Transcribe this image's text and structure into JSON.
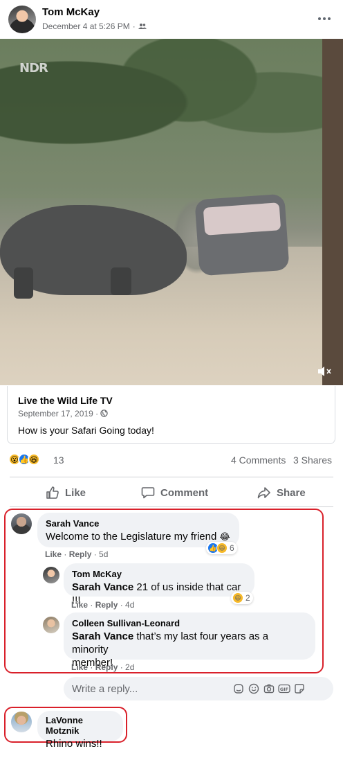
{
  "post": {
    "author": "Tom McKay",
    "time": "December 4 at 5:26 PM",
    "audience_icon": "friends-icon",
    "more_icon": "more-icon"
  },
  "video": {
    "watermark": "NDR",
    "mute_icon": "speaker-muted-icon"
  },
  "link_card": {
    "title": "Live the Wild Life TV",
    "date": "September 17, 2019 ·",
    "globe_icon": "globe-icon",
    "text": "How is your Safari Going today!"
  },
  "summary": {
    "reaction_icons": [
      "wow-icon",
      "like-icon",
      "haha-icon"
    ],
    "reaction_count": "13",
    "comments": "4 Comments",
    "shares": "3 Shares"
  },
  "actions": {
    "like": "Like",
    "comment": "Comment",
    "share": "Share"
  },
  "comments": [
    {
      "name": "Sarah Vance",
      "text": "Welcome to the Legislature my friend",
      "emoji": "😂",
      "like": "Like",
      "reply": "Reply",
      "age": "5d",
      "reaction_count": "6"
    },
    {
      "name": "Tom McKay",
      "tag": "Sarah Vance",
      "text": "21 of us inside that car !!!",
      "like": "Like",
      "reply": "Reply",
      "age": "4d",
      "reaction_count": "2"
    },
    {
      "name": "Colleen Sullivan-Leonard",
      "tag": "Sarah Vance",
      "text_line1": "that’s my last four years as a minority",
      "text_line2": "member!",
      "like": "Like",
      "reply": "Reply",
      "age": "2d"
    },
    {
      "name": "LaVonne Motznik",
      "text": "Rhino wins!!"
    }
  ],
  "reply_box": {
    "placeholder": "Write a reply..."
  },
  "colors": {
    "highlight_border": "#d9202a",
    "like_blue": "#1877f2",
    "reaction_yellow": "#f7b928"
  }
}
